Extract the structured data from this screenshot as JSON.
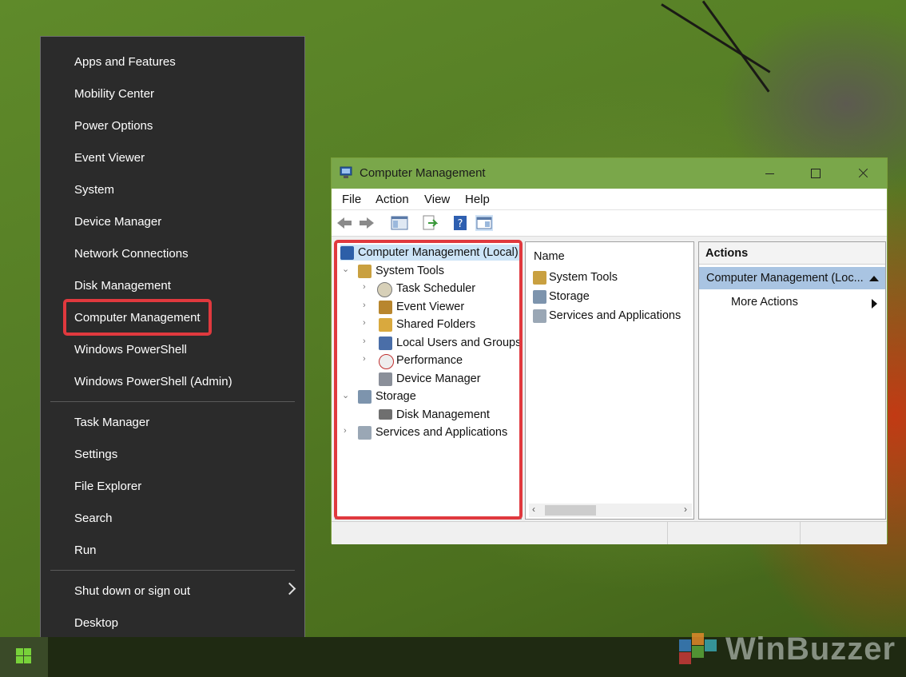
{
  "winx_menu": {
    "items": [
      {
        "label": "Apps and Features"
      },
      {
        "label": "Mobility Center"
      },
      {
        "label": "Power Options"
      },
      {
        "label": "Event Viewer"
      },
      {
        "label": "System"
      },
      {
        "label": "Device Manager"
      },
      {
        "label": "Network Connections"
      },
      {
        "label": "Disk Management"
      },
      {
        "label": "Computer Management",
        "highlighted": true
      },
      {
        "label": "Windows PowerShell"
      },
      {
        "label": "Windows PowerShell (Admin)"
      },
      {
        "label": "Task Manager"
      },
      {
        "label": "Settings"
      },
      {
        "label": "File Explorer"
      },
      {
        "label": "Search"
      },
      {
        "label": "Run"
      },
      {
        "label": "Shut down or sign out",
        "has_submenu": true
      },
      {
        "label": "Desktop"
      }
    ]
  },
  "window": {
    "title": "Computer Management",
    "menu": [
      "File",
      "Action",
      "View",
      "Help"
    ],
    "tree": [
      {
        "label": "Computer Management (Local)",
        "selected": true,
        "icon": "computer-management-icon"
      },
      {
        "label": "System Tools",
        "expanded": true,
        "icon": "tools-icon"
      },
      {
        "label": "Task Scheduler",
        "icon": "clock-icon"
      },
      {
        "label": "Event Viewer",
        "icon": "event-viewer-icon"
      },
      {
        "label": "Shared Folders",
        "icon": "shared-folder-icon"
      },
      {
        "label": "Local Users and Groups",
        "icon": "users-icon"
      },
      {
        "label": "Performance",
        "icon": "performance-icon"
      },
      {
        "label": "Device Manager",
        "icon": "device-manager-icon"
      },
      {
        "label": "Storage",
        "expanded": true,
        "icon": "storage-icon"
      },
      {
        "label": "Disk Management",
        "icon": "disk-icon"
      },
      {
        "label": "Services and Applications",
        "icon": "services-icon"
      }
    ],
    "list": {
      "header": "Name",
      "rows": [
        "System Tools",
        "Storage",
        "Services and Applications"
      ]
    },
    "actions": {
      "header": "Actions",
      "section": "Computer Management (Loc...",
      "more": "More Actions"
    }
  },
  "watermark": "WinBuzzer",
  "colors": {
    "highlight": "#e0393e",
    "titlebar": "#7aa74a",
    "menu_bg": "#2b2b2b",
    "action_section": "#a9c4e2"
  }
}
